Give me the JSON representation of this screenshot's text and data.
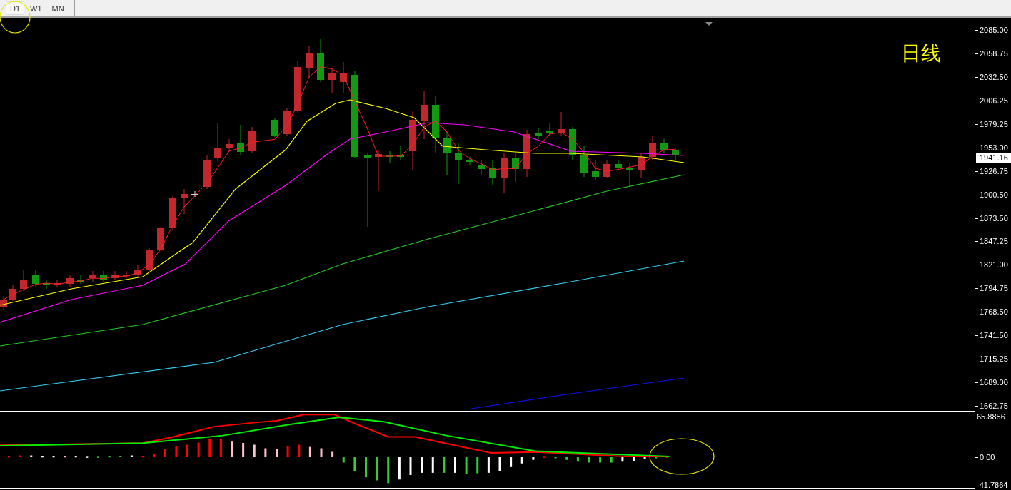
{
  "timeframe_tabs": [
    {
      "label": "D1",
      "selected": true
    },
    {
      "label": "W1",
      "selected": false
    },
    {
      "label": "MN",
      "selected": false
    }
  ],
  "price_chart": {
    "label": "日线",
    "current_price": "1941.16",
    "price_axis": [
      "2085.00",
      "2058.75",
      "2032.50",
      "2006.25",
      "1979.25",
      "1953.00",
      "1926.75",
      "1900.50",
      "1873.50",
      "1847.25",
      "1821.00",
      "1794.75",
      "1768.50",
      "1741.50",
      "1715.25",
      "1689.00",
      "1662.75"
    ]
  },
  "indicator": {
    "axis": [
      "65.8856",
      "0.00",
      "-41.7864"
    ]
  }
}
